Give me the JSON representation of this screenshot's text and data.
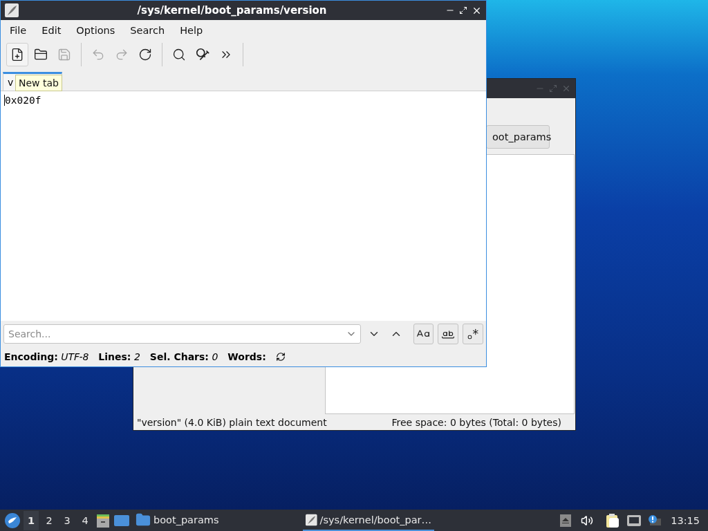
{
  "editor_window": {
    "title": "/sys/kernel/boot_params/version",
    "menu": [
      "File",
      "Edit",
      "Options",
      "Search",
      "Help"
    ],
    "toolbar": [
      {
        "kind": "new-tab",
        "disabled": false,
        "hovered": true
      },
      {
        "kind": "open",
        "disabled": false,
        "hovered": false
      },
      {
        "kind": "save",
        "disabled": true,
        "hovered": false
      },
      {
        "kind": "undo",
        "disabled": true,
        "hovered": false
      },
      {
        "kind": "redo",
        "disabled": true,
        "hovered": false
      },
      {
        "kind": "reload",
        "disabled": false,
        "hovered": false
      },
      {
        "kind": "find",
        "disabled": false,
        "hovered": false
      },
      {
        "kind": "replace",
        "disabled": false,
        "hovered": false
      },
      {
        "kind": "more",
        "disabled": false,
        "hovered": false
      }
    ],
    "tabs": [
      {
        "label": "v",
        "selected": true
      }
    ],
    "tooltip": "New tab",
    "content": "0x020f",
    "search": {
      "placeholder": "Search..."
    },
    "status": [
      "**Encoding:** *UTF-8*",
      "**Lines:** *2*",
      "**Sel. Chars:** *0*",
      "**Words:**"
    ]
  },
  "file_manager_window": {
    "path_button": "oot_params",
    "status_left": "\"version\" (4.0 KiB) plain text document",
    "status_right": "Free space: 0 bytes (Total: 0 bytes)"
  },
  "taskbar": {
    "workspaces": [
      {
        "label": "1",
        "selected": true
      },
      {
        "label": "2",
        "selected": false
      },
      {
        "label": "3",
        "selected": false
      },
      {
        "label": "4",
        "selected": false
      }
    ],
    "tasks": [
      {
        "kind": "folder",
        "label": "boot_params",
        "selected": false
      },
      {
        "kind": "editor",
        "label": "/sys/kernel/boot_par…",
        "selected": true
      }
    ],
    "clock": "13:15"
  }
}
